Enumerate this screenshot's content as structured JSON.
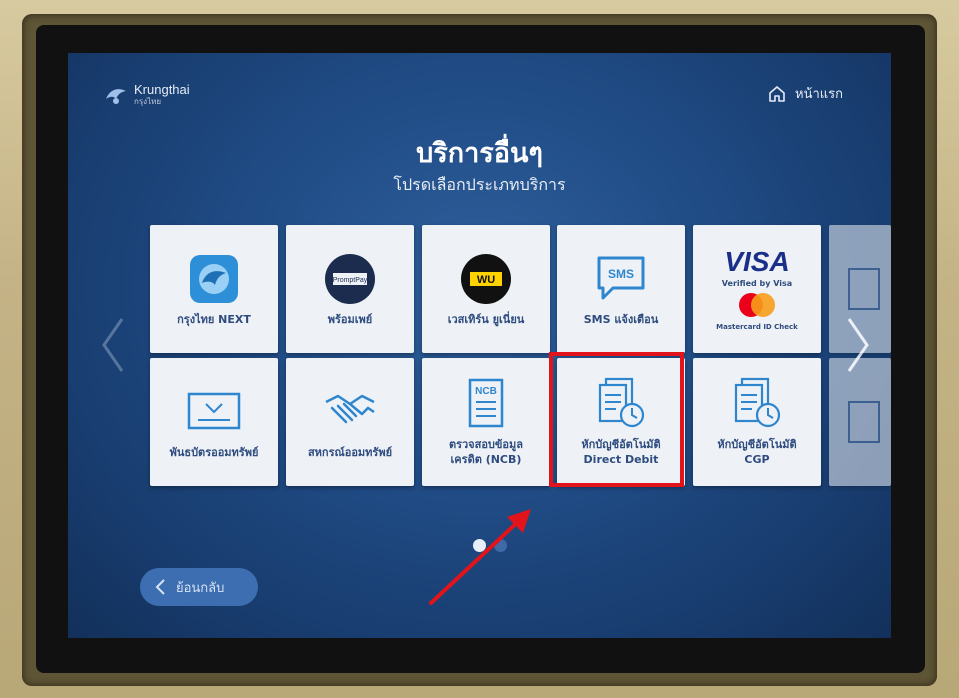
{
  "brand": {
    "name": "Krungthai",
    "sub": "กรุงไทย",
    "icon": "krungthai-bird-logo"
  },
  "header": {
    "home_label": "หน้าแรก",
    "home_icon": "home-icon"
  },
  "page": {
    "title": "บริการอื่นๆ",
    "subtitle": "โปรดเลือกประเภทบริการ"
  },
  "tiles_row1": [
    {
      "label": "กรุงไทย NEXT",
      "icon": "krungthai-next-icon"
    },
    {
      "label": "พร้อมเพย์",
      "icon": "promptpay-icon",
      "badge": "PromptPay"
    },
    {
      "label": "เวสเทิร์น ยูเนี่ยน",
      "icon": "western-union-icon",
      "badge": "WU"
    },
    {
      "label": "SMS แจ้งเตือน",
      "icon": "sms-icon",
      "badge": "SMS"
    },
    {
      "label_top": "VISA",
      "label_mid": "Verified by Visa",
      "label_bottom": "Mastercard ID Check",
      "icon": "visa-mastercard-icon"
    },
    {
      "label": "",
      "icon": "partial-tile-icon"
    }
  ],
  "tiles_row2": [
    {
      "label": "พันธบัตรออมทรัพย์",
      "icon": "bond-certificate-icon"
    },
    {
      "label": "สหกรณ์ออมทรัพย์",
      "icon": "handshake-icon"
    },
    {
      "label": "ตรวจสอบข้อมูล",
      "label2": "เครดิต (NCB)",
      "icon": "ncb-document-icon",
      "badge": "NCB"
    },
    {
      "label": "หักบัญชีอัตโนมัติ",
      "label2": "Direct Debit",
      "icon": "direct-debit-icon"
    },
    {
      "label": "หักบัญชีอัตโนมัติ",
      "label2": "CGP",
      "icon": "cgp-debit-icon"
    },
    {
      "label": "",
      "icon": "partial-tile-icon"
    }
  ],
  "pagination": {
    "current": 1,
    "total": 2
  },
  "footer": {
    "back_label": "ย้อนกลับ",
    "back_icon": "chevron-left-icon"
  },
  "colors": {
    "accent": "#2f4c7f",
    "highlight": "#e0141a",
    "screen_bg": "#1f4a83",
    "button": "#3d6eb1"
  }
}
